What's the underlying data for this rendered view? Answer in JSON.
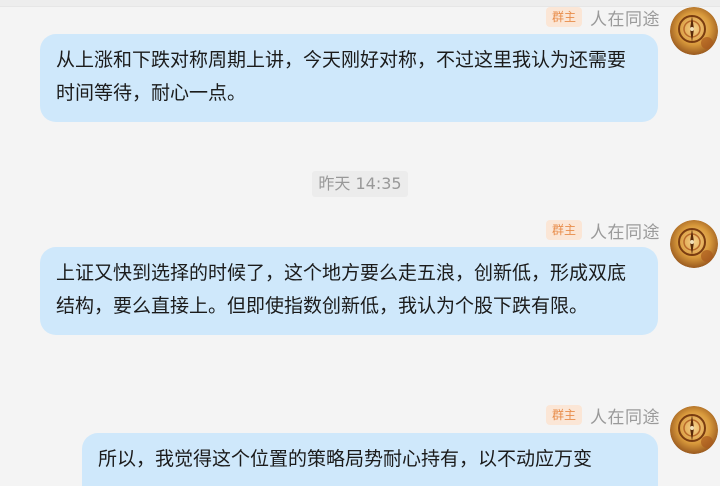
{
  "messages": [
    {
      "role": "群主",
      "sender": "人在同途",
      "text": "从上涨和下跌对称周期上讲，今天刚好对称，不过这里我认为还需要时间等待，耐心一点。"
    },
    {
      "role": "群主",
      "sender": "人在同途",
      "text": "上证又快到选择的时候了，这个地方要么走五浪，创新低，形成双底结构，要么直接上。但即使指数创新低，我认为个股下跌有限。"
    },
    {
      "role": "群主",
      "sender": "人在同途",
      "text": "所以，我觉得这个位置的策略局势耐心持有，以不动应万变"
    }
  ],
  "timestamp": "昨天 14:35",
  "colors": {
    "bubble": "#cfe8fb",
    "badge_bg": "#fbe6d6",
    "badge_text": "#e88d4b",
    "name": "#9a9a9a",
    "background": "#f4f4f4"
  }
}
